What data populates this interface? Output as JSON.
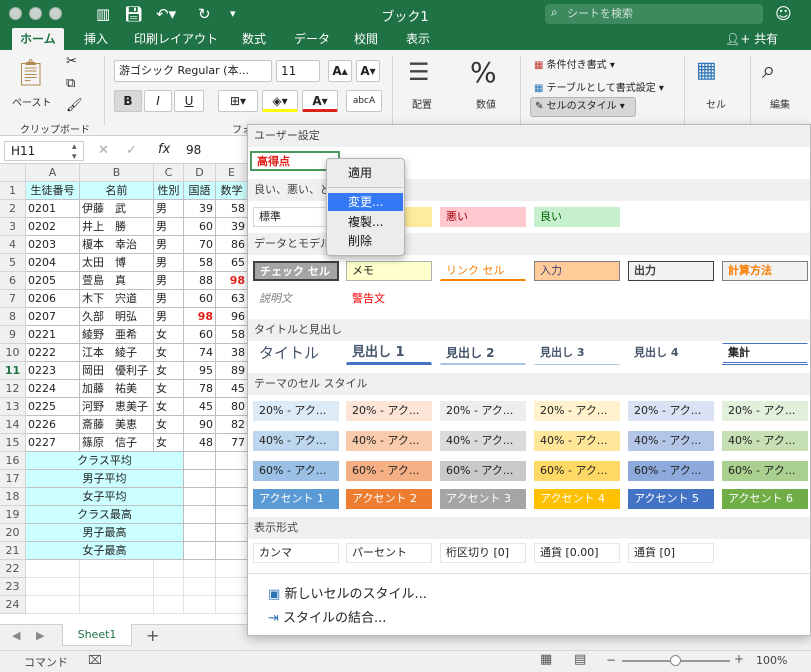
{
  "window": {
    "title": "ブック1",
    "search_placeholder": "シートを検索"
  },
  "tabs": [
    "ホーム",
    "挿入",
    "印刷レイアウト",
    "数式",
    "データ",
    "校閲",
    "表示"
  ],
  "share_label": "共有",
  "ribbon": {
    "paste_label": "ペースト",
    "clipboard_label": "クリップボード",
    "font_name": "游ゴシック Regular (本...",
    "font_size": "11",
    "font_group_label": "フォ",
    "bold": "B",
    "italic": "I",
    "underline": "U",
    "align_label": "配置",
    "number_label": "数値",
    "cond_format": "条件付き書式",
    "table_format": "テーブルとして書式設定",
    "cell_style": "セルのスタイル",
    "cells_label": "セル",
    "edit_label": "編集"
  },
  "formula_bar": {
    "name_box": "H11",
    "value": "98"
  },
  "columns": [
    "A",
    "B",
    "C",
    "D",
    "E"
  ],
  "rows": [
    "1",
    "2",
    "3",
    "4",
    "5",
    "6",
    "7",
    "8",
    "9",
    "10",
    "11",
    "12",
    "13",
    "14",
    "15",
    "16",
    "17",
    "18",
    "19",
    "20",
    "21",
    "22",
    "23",
    "24"
  ],
  "header_row": [
    "生徒番号",
    "名前",
    "性別",
    "国語",
    "数学"
  ],
  "students": [
    [
      "0201",
      "伊藤　武",
      "男",
      "39",
      "58"
    ],
    [
      "0202",
      "井上　勝",
      "男",
      "60",
      "39"
    ],
    [
      "0203",
      "榎本　幸治",
      "男",
      "70",
      "86"
    ],
    [
      "0204",
      "太田　博",
      "男",
      "58",
      "65"
    ],
    [
      "0205",
      "萱島　真",
      "男",
      "88",
      "98"
    ],
    [
      "0206",
      "木下　宍道",
      "男",
      "60",
      "63"
    ],
    [
      "0207",
      "久部　明弘",
      "男",
      "98",
      "96"
    ],
    [
      "0221",
      "綾野　亜希",
      "女",
      "60",
      "58"
    ],
    [
      "0222",
      "江本　綾子",
      "女",
      "74",
      "38"
    ],
    [
      "0223",
      "岡田　優利子",
      "女",
      "95",
      "89"
    ],
    [
      "0224",
      "加藤　祐美",
      "女",
      "78",
      "45"
    ],
    [
      "0225",
      "河野　恵美子",
      "女",
      "45",
      "80"
    ],
    [
      "0226",
      "斎藤　美恵",
      "女",
      "90",
      "82"
    ],
    [
      "0227",
      "篠原　信子",
      "女",
      "48",
      "77"
    ]
  ],
  "summary_labels": [
    "クラス平均",
    "男子平均",
    "女子平均",
    "クラス最高",
    "男子最高",
    "女子最高"
  ],
  "sheet_tab": "Sheet1",
  "status": {
    "mode": "コマンド",
    "zoom": "100%"
  },
  "gallery": {
    "sections": {
      "user": "ユーザー設定",
      "good_bad": "良い、悪い、ど",
      "data_model": "データとモデル",
      "title_heading": "タイトルと見出し",
      "theme": "テーマのセル スタイル",
      "number_format": "表示形式"
    },
    "user_styles": [
      "高得点"
    ],
    "good_bad_styles": [
      "標準",
      "どちら...",
      "悪い",
      "良い"
    ],
    "data_styles_1": [
      "チェック セル",
      "メモ",
      "リンク セル",
      "入力",
      "出力",
      "計算方法"
    ],
    "data_styles_2": [
      "説明文",
      "警告文"
    ],
    "title_styles": [
      "タイトル",
      "見出し 1",
      "見出し 2",
      "見出し 3",
      "見出し 4",
      "集計"
    ],
    "theme_20": [
      "20% - アク...",
      "20% - アク...",
      "20% - アク...",
      "20% - アク...",
      "20% - アク...",
      "20% - アク..."
    ],
    "theme_40": [
      "40% - アク...",
      "40% - アク...",
      "40% - アク...",
      "40% - アク...",
      "40% - アク...",
      "40% - アク..."
    ],
    "theme_60": [
      "60% - アク...",
      "60% - アク...",
      "60% - アク...",
      "60% - アク...",
      "60% - アク...",
      "60% - アク..."
    ],
    "theme_accent": [
      "アクセント 1",
      "アクセント 2",
      "アクセント 3",
      "アクセント 4",
      "アクセント 5",
      "アクセント 6"
    ],
    "number_styles": [
      "カンマ",
      "パーセント",
      "桁区切り [0]",
      "通貨 [0.00]",
      "通貨 [0]"
    ],
    "new_style": "新しいセルのスタイル...",
    "merge_style": "スタイルの結合..."
  },
  "context_menu": {
    "items": [
      "適用",
      "変更...",
      "複製...",
      "削除"
    ],
    "selected": "変更..."
  },
  "accent_colors": {
    "a1": "#5b9bd5",
    "a2": "#ed7d31",
    "a3": "#a5a5a5",
    "a4": "#ffc000",
    "a5": "#4472c4",
    "a6": "#70ad47",
    "excel_green": "#1f7244"
  }
}
